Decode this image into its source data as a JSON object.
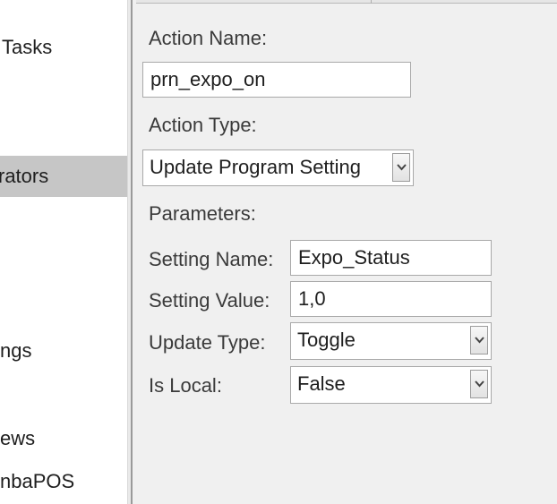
{
  "sidebar": {
    "items": [
      {
        "label": "Tasks"
      },
      {
        "label": "rators"
      },
      {
        "label": "ngs"
      },
      {
        "label": "ews"
      },
      {
        "label": "nbaPOS"
      }
    ]
  },
  "form": {
    "action_name_label": "Action Name:",
    "action_name_value": "prn_expo_on",
    "action_type_label": "Action Type:",
    "action_type_value": "Update Program Setting",
    "parameters_label": "Parameters:",
    "setting_name_label": "Setting Name:",
    "setting_name_value": "Expo_Status",
    "setting_value_label": "Setting Value:",
    "setting_value_value": "1,0",
    "update_type_label": "Update Type:",
    "update_type_value": "Toggle",
    "is_local_label": "Is Local:",
    "is_local_value": "False"
  },
  "icons": {
    "dropdown": "chevron-down-icon"
  },
  "colors": {
    "selected_item_bg": "#c6c6c6",
    "panel_bg": "#f0f0f0",
    "field_border": "#a9a9a9"
  }
}
